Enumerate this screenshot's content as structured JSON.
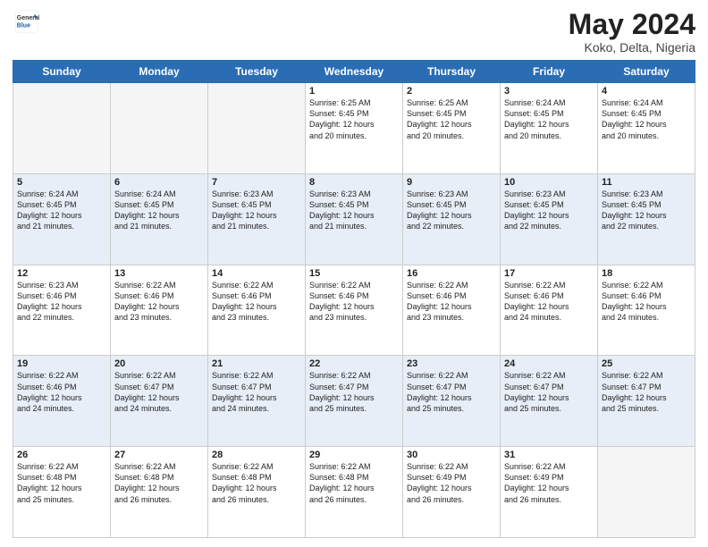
{
  "header": {
    "logo_general": "General",
    "logo_blue": "Blue",
    "title": "May 2024",
    "location": "Koko, Delta, Nigeria"
  },
  "weekdays": [
    "Sunday",
    "Monday",
    "Tuesday",
    "Wednesday",
    "Thursday",
    "Friday",
    "Saturday"
  ],
  "rows": [
    [
      {
        "day": "",
        "content": ""
      },
      {
        "day": "",
        "content": ""
      },
      {
        "day": "",
        "content": ""
      },
      {
        "day": "1",
        "content": "Sunrise: 6:25 AM\nSunset: 6:45 PM\nDaylight: 12 hours\nand 20 minutes."
      },
      {
        "day": "2",
        "content": "Sunrise: 6:25 AM\nSunset: 6:45 PM\nDaylight: 12 hours\nand 20 minutes."
      },
      {
        "day": "3",
        "content": "Sunrise: 6:24 AM\nSunset: 6:45 PM\nDaylight: 12 hours\nand 20 minutes."
      },
      {
        "day": "4",
        "content": "Sunrise: 6:24 AM\nSunset: 6:45 PM\nDaylight: 12 hours\nand 20 minutes."
      }
    ],
    [
      {
        "day": "5",
        "content": "Sunrise: 6:24 AM\nSunset: 6:45 PM\nDaylight: 12 hours\nand 21 minutes."
      },
      {
        "day": "6",
        "content": "Sunrise: 6:24 AM\nSunset: 6:45 PM\nDaylight: 12 hours\nand 21 minutes."
      },
      {
        "day": "7",
        "content": "Sunrise: 6:23 AM\nSunset: 6:45 PM\nDaylight: 12 hours\nand 21 minutes."
      },
      {
        "day": "8",
        "content": "Sunrise: 6:23 AM\nSunset: 6:45 PM\nDaylight: 12 hours\nand 21 minutes."
      },
      {
        "day": "9",
        "content": "Sunrise: 6:23 AM\nSunset: 6:45 PM\nDaylight: 12 hours\nand 22 minutes."
      },
      {
        "day": "10",
        "content": "Sunrise: 6:23 AM\nSunset: 6:45 PM\nDaylight: 12 hours\nand 22 minutes."
      },
      {
        "day": "11",
        "content": "Sunrise: 6:23 AM\nSunset: 6:45 PM\nDaylight: 12 hours\nand 22 minutes."
      }
    ],
    [
      {
        "day": "12",
        "content": "Sunrise: 6:23 AM\nSunset: 6:46 PM\nDaylight: 12 hours\nand 22 minutes."
      },
      {
        "day": "13",
        "content": "Sunrise: 6:22 AM\nSunset: 6:46 PM\nDaylight: 12 hours\nand 23 minutes."
      },
      {
        "day": "14",
        "content": "Sunrise: 6:22 AM\nSunset: 6:46 PM\nDaylight: 12 hours\nand 23 minutes."
      },
      {
        "day": "15",
        "content": "Sunrise: 6:22 AM\nSunset: 6:46 PM\nDaylight: 12 hours\nand 23 minutes."
      },
      {
        "day": "16",
        "content": "Sunrise: 6:22 AM\nSunset: 6:46 PM\nDaylight: 12 hours\nand 23 minutes."
      },
      {
        "day": "17",
        "content": "Sunrise: 6:22 AM\nSunset: 6:46 PM\nDaylight: 12 hours\nand 24 minutes."
      },
      {
        "day": "18",
        "content": "Sunrise: 6:22 AM\nSunset: 6:46 PM\nDaylight: 12 hours\nand 24 minutes."
      }
    ],
    [
      {
        "day": "19",
        "content": "Sunrise: 6:22 AM\nSunset: 6:46 PM\nDaylight: 12 hours\nand 24 minutes."
      },
      {
        "day": "20",
        "content": "Sunrise: 6:22 AM\nSunset: 6:47 PM\nDaylight: 12 hours\nand 24 minutes."
      },
      {
        "day": "21",
        "content": "Sunrise: 6:22 AM\nSunset: 6:47 PM\nDaylight: 12 hours\nand 24 minutes."
      },
      {
        "day": "22",
        "content": "Sunrise: 6:22 AM\nSunset: 6:47 PM\nDaylight: 12 hours\nand 25 minutes."
      },
      {
        "day": "23",
        "content": "Sunrise: 6:22 AM\nSunset: 6:47 PM\nDaylight: 12 hours\nand 25 minutes."
      },
      {
        "day": "24",
        "content": "Sunrise: 6:22 AM\nSunset: 6:47 PM\nDaylight: 12 hours\nand 25 minutes."
      },
      {
        "day": "25",
        "content": "Sunrise: 6:22 AM\nSunset: 6:47 PM\nDaylight: 12 hours\nand 25 minutes."
      }
    ],
    [
      {
        "day": "26",
        "content": "Sunrise: 6:22 AM\nSunset: 6:48 PM\nDaylight: 12 hours\nand 25 minutes."
      },
      {
        "day": "27",
        "content": "Sunrise: 6:22 AM\nSunset: 6:48 PM\nDaylight: 12 hours\nand 26 minutes."
      },
      {
        "day": "28",
        "content": "Sunrise: 6:22 AM\nSunset: 6:48 PM\nDaylight: 12 hours\nand 26 minutes."
      },
      {
        "day": "29",
        "content": "Sunrise: 6:22 AM\nSunset: 6:48 PM\nDaylight: 12 hours\nand 26 minutes."
      },
      {
        "day": "30",
        "content": "Sunrise: 6:22 AM\nSunset: 6:49 PM\nDaylight: 12 hours\nand 26 minutes."
      },
      {
        "day": "31",
        "content": "Sunrise: 6:22 AM\nSunset: 6:49 PM\nDaylight: 12 hours\nand 26 minutes."
      },
      {
        "day": "",
        "content": ""
      }
    ]
  ]
}
